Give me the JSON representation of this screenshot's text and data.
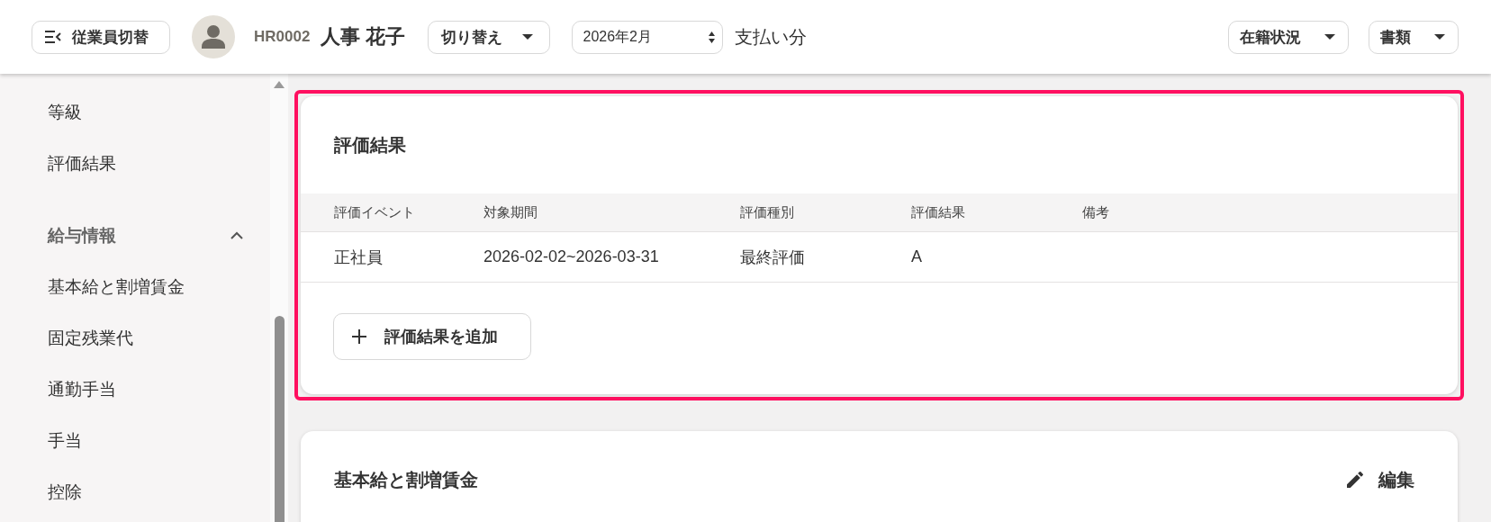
{
  "header": {
    "switch_button": "従業員切替",
    "employee_id": "HR0002",
    "employee_name": "人事 花子",
    "switch_dropdown": "切り替え",
    "period_select": "2026年2月",
    "period_suffix": "支払い分",
    "menus": [
      "在籍状況",
      "書類"
    ]
  },
  "sidebar": {
    "sections": [
      {
        "items": [
          "等級",
          "評価結果"
        ]
      },
      {
        "title": "給与情報",
        "expanded": true,
        "items": [
          "基本給と割増賃金",
          "固定残業代",
          "通勤手当",
          "手当",
          "控除"
        ]
      }
    ]
  },
  "cards": [
    {
      "title": "評価結果",
      "highlighted": true,
      "table": {
        "columns": [
          "評価イベント",
          "対象期間",
          "評価種別",
          "評価結果",
          "備考"
        ],
        "rows": [
          [
            "正社員",
            "2026-02-02~2026-03-31",
            "最終評価",
            "A"
          ]
        ]
      },
      "add_button": "評価結果を追加"
    },
    {
      "title": "基本給と割増賃金",
      "highlighted": false,
      "edit_button": "編集"
    }
  ]
}
